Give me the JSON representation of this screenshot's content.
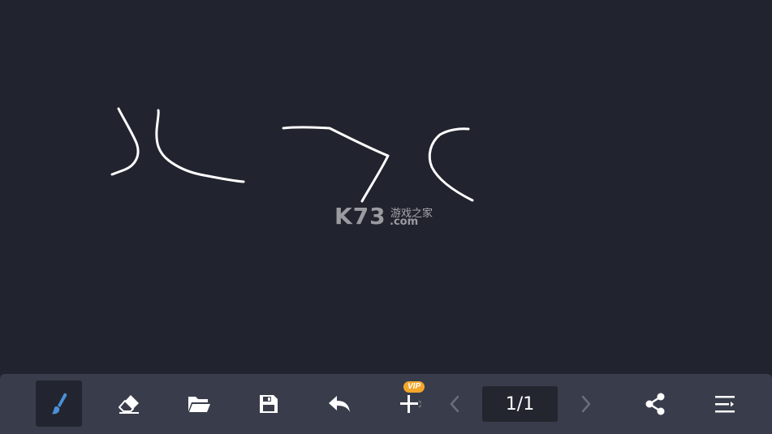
{
  "canvas": {
    "background": "#21232e",
    "stroke_color": "#ffffff"
  },
  "watermark": {
    "brand": "K73",
    "tagline": "游戏之家",
    "domain": ".com"
  },
  "toolbar": {
    "background": "#393d4b",
    "accent": "#4a90d9",
    "tools": [
      {
        "name": "brush",
        "icon": "brush-icon",
        "active": true
      },
      {
        "name": "eraser",
        "icon": "eraser-icon",
        "active": false
      },
      {
        "name": "open",
        "icon": "folder-icon",
        "active": false
      },
      {
        "name": "save",
        "icon": "save-icon",
        "active": false
      },
      {
        "name": "undo",
        "icon": "undo-icon",
        "active": false
      },
      {
        "name": "add-page",
        "icon": "plus-icon",
        "active": false
      },
      {
        "name": "previous-page",
        "icon": "chevron-left-icon",
        "active": false
      },
      {
        "name": "next-page",
        "icon": "chevron-right-icon",
        "active": false
      },
      {
        "name": "share",
        "icon": "share-icon",
        "active": false
      },
      {
        "name": "menu",
        "icon": "menu-icon",
        "active": false
      }
    ],
    "vip_badge": "VIP",
    "page_indicator": "1/1"
  }
}
